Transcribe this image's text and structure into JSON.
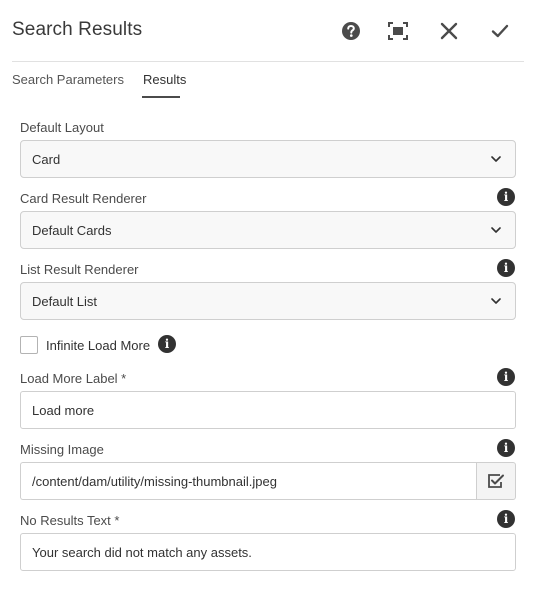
{
  "dialog": {
    "title": "Search Results",
    "help_icon": "help-icon",
    "fullscreen_icon": "fullscreen-icon",
    "close_icon": "close-icon",
    "done_icon": "check-icon"
  },
  "tabs": [
    {
      "label": "Search Parameters",
      "active": false
    },
    {
      "label": "Results",
      "active": true
    }
  ],
  "form": {
    "default_layout": {
      "label": "Default Layout",
      "value": "Card"
    },
    "card_result_renderer": {
      "label": "Card Result Renderer",
      "value": "Default Cards",
      "info_icon": "info-icon"
    },
    "list_result_renderer": {
      "label": "List Result Renderer",
      "value": "Default List",
      "info_icon": "info-icon"
    },
    "infinite_load_more": {
      "label": "Infinite Load More",
      "checked": false,
      "info_icon": "info-icon"
    },
    "load_more_label": {
      "label": "Load More Label *",
      "value": "Load more",
      "info_icon": "info-icon"
    },
    "missing_image": {
      "label": "Missing Image",
      "value": "/content/dam/utility/missing-thumbnail.jpeg",
      "picker_icon": "select-checkbox-icon",
      "info_icon": "info-icon"
    },
    "no_results_text": {
      "label": "No Results Text *",
      "value": "Your search did not match any assets.",
      "info_icon": "info-icon"
    }
  },
  "info_glyph": "i"
}
